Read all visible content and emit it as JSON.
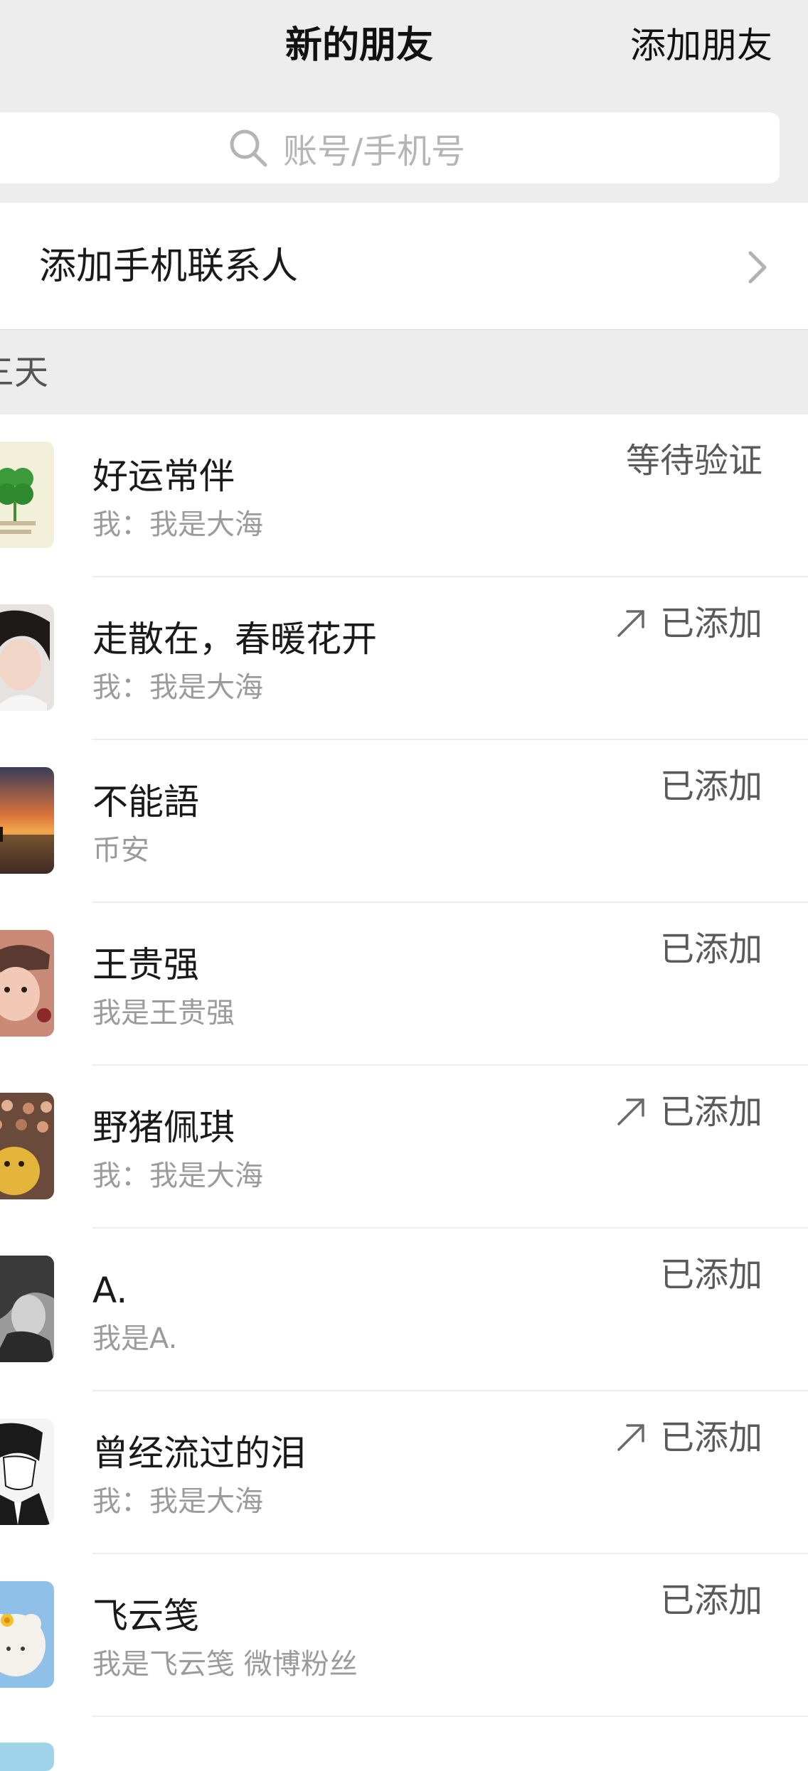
{
  "header": {
    "title": "新的朋友",
    "add_friend": "添加朋友"
  },
  "search": {
    "placeholder": "账号/手机号"
  },
  "phone_contacts": {
    "label": "添加手机联系人"
  },
  "section": {
    "label": "三天"
  },
  "friends": [
    {
      "name": "好运常伴",
      "message": "我：我是大海",
      "status": "等待验证",
      "shared": false,
      "avatar": "four-leaf-clover-avatar"
    },
    {
      "name": "走散在，春暖花开",
      "message": "我：我是大海",
      "status": "已添加",
      "shared": true,
      "avatar": "portrait-avatar"
    },
    {
      "name": "不能語",
      "message": "币安",
      "status": "已添加",
      "shared": false,
      "avatar": "sunset-avatar"
    },
    {
      "name": "王贵强",
      "message": "我是王贵强",
      "status": "已添加",
      "shared": false,
      "avatar": "baby-avatar"
    },
    {
      "name": "野猪佩琪",
      "message": "我：我是大海",
      "status": "已添加",
      "shared": true,
      "avatar": "toy-avatar"
    },
    {
      "name": "A.",
      "message": "我是A.",
      "status": "已添加",
      "shared": false,
      "avatar": "bw-photo-avatar"
    },
    {
      "name": "曾经流过的泪",
      "message": "我：我是大海",
      "status": "已添加",
      "shared": true,
      "avatar": "sketch-avatar"
    },
    {
      "name": "飞云笺",
      "message": "我是飞云笺 微博粉丝",
      "status": "已添加",
      "shared": false,
      "avatar": "lamb-avatar"
    }
  ],
  "colors": {
    "header_bg": "#ededed",
    "status_text": "#5a5a5a",
    "secondary_text": "#9b9b9b"
  }
}
